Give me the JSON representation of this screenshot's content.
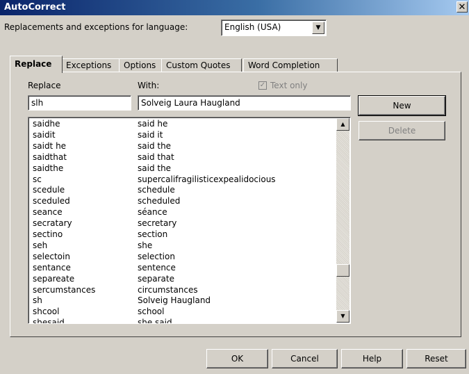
{
  "window": {
    "title": "AutoCorrect",
    "close_glyph": "✕"
  },
  "language": {
    "label": "Replacements and exceptions for language:",
    "value": "English (USA)"
  },
  "tabs": [
    {
      "label": "Replace"
    },
    {
      "label": "Exceptions"
    },
    {
      "label": "Options"
    },
    {
      "label": "Custom Quotes"
    },
    {
      "label": "Word Completion"
    }
  ],
  "replace": {
    "replace_label": "Replace",
    "with_label": "With:",
    "text_only_label": "Text only",
    "text_only_checked": true,
    "replace_value": "slh",
    "with_value": "Solveig Laura Haugland"
  },
  "entries": [
    [
      "saidhe",
      "said he"
    ],
    [
      "saidit",
      "said it"
    ],
    [
      "saidt he",
      "said the"
    ],
    [
      "saidthat",
      "said that"
    ],
    [
      "saidthe",
      "said the"
    ],
    [
      "sc",
      "supercalifragilisticexpealidocious"
    ],
    [
      "scedule",
      "schedule"
    ],
    [
      "sceduled",
      "scheduled"
    ],
    [
      "seance",
      "séance"
    ],
    [
      "secratary",
      "secretary"
    ],
    [
      "sectino",
      "section"
    ],
    [
      "seh",
      "she"
    ],
    [
      "selectoin",
      "selection"
    ],
    [
      "sentance",
      "sentence"
    ],
    [
      "separeate",
      "separate"
    ],
    [
      "sercumstances",
      "circumstances"
    ],
    [
      "sh",
      "Solveig Haugland"
    ],
    [
      "shcool",
      "school"
    ],
    [
      "shesaid",
      "she said"
    ]
  ],
  "buttons": {
    "new": "New",
    "delete": "Delete",
    "ok": "OK",
    "cancel": "Cancel",
    "help": "Help",
    "reset": "Reset"
  },
  "icons": {
    "dropdown": "dropdown-arrow-icon",
    "scroll_up": "scroll-up-icon",
    "scroll_down": "scroll-down-icon",
    "checkmark": "checkmark-icon"
  }
}
